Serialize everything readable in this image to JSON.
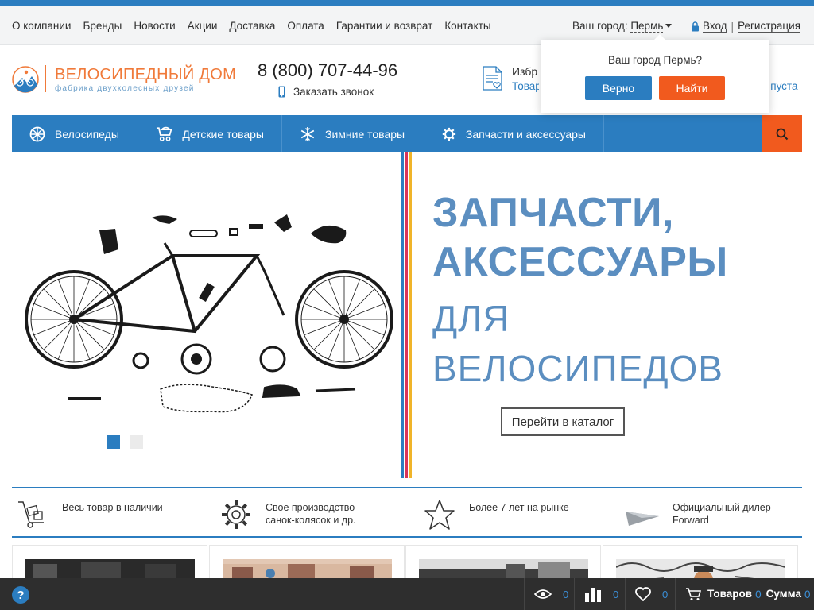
{
  "topbar": {
    "nav": [
      "О компании",
      "Бренды",
      "Новости",
      "Акции",
      "Доставка",
      "Оплата",
      "Гарантии и возврат",
      "Контакты"
    ],
    "city_label": "Ваш город:",
    "city_value": "Пермь",
    "login": "Вход",
    "separator": "|",
    "register": "Регистрация"
  },
  "header": {
    "logo_name": "ВЕЛОСИПЕДНЫЙ ДОМ",
    "logo_tagline": "фабрика двухколесных друзей",
    "phone": "8 (800) 707-44-96",
    "callback": "Заказать звонок",
    "favorites_title": "Избр",
    "favorites_link": "Товар",
    "cart_status": "а пуста"
  },
  "city_popup": {
    "question": "Ваш город Пермь?",
    "confirm": "Верно",
    "find": "Найти"
  },
  "main_nav": [
    {
      "label": "Велосипеды",
      "icon": "wheel-icon"
    },
    {
      "label": "Детские товары",
      "icon": "stroller-icon"
    },
    {
      "label": "Зимние товары",
      "icon": "snowflake-icon"
    },
    {
      "label": "Запчасти и аксессуары",
      "icon": "gear-icon"
    }
  ],
  "banner": {
    "line1": "ЗАПЧАСТИ,",
    "line2": "АКСЕССУАРЫ",
    "line3": "ДЛЯ",
    "line4": "ВЕЛОСИПЕДОВ",
    "button": "Перейти в каталог",
    "slides": 2,
    "active_slide": 1,
    "stripe_colors": [
      "#2b7dc0",
      "#d9345a",
      "#f0b429"
    ]
  },
  "features": [
    {
      "icon": "cart-boxes-icon",
      "line1": "Весь товар в наличии",
      "line2": ""
    },
    {
      "icon": "gear-icon",
      "line1": "Свое производство",
      "line2": "санок-колясок и др."
    },
    {
      "icon": "star-icon",
      "line1": "Более 7 лет на рынке",
      "line2": ""
    },
    {
      "icon": "forward-logo-icon",
      "line1": "Официальный дилер",
      "line2": "Forward"
    }
  ],
  "bottom_bar": {
    "viewed_count": "0",
    "compare_count": "0",
    "favorites_count": "0",
    "goods_label": "Товаров",
    "goods_count": "0",
    "sum_label": "Сумма",
    "sum_value": "0"
  },
  "colors": {
    "primary": "#2b7dc0",
    "accent": "#f15a1e",
    "banner_text": "#5b8ec0"
  }
}
